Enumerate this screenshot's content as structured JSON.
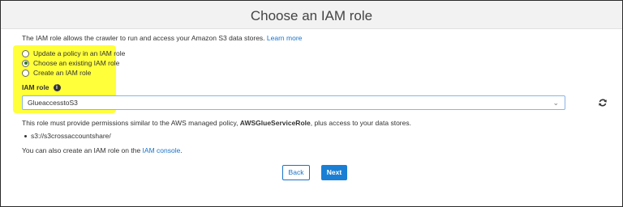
{
  "header": {
    "title": "Choose an IAM role"
  },
  "intro": {
    "text": "The IAM role allows the crawler to run and access your Amazon S3 data stores.",
    "link": "Learn more"
  },
  "role_options": [
    {
      "label": "Update a policy in an IAM role",
      "checked": false
    },
    {
      "label": "Choose an existing IAM role",
      "checked": true
    },
    {
      "label": "Create an IAM role",
      "checked": false
    }
  ],
  "iam_role": {
    "label": "IAM role",
    "info_icon": "info-icon",
    "selected": "GlueaccesstoS3",
    "refresh_icon": "refresh-icon"
  },
  "permissions": {
    "prefix": "This role must provide permissions similar to the AWS managed policy, ",
    "policy": "AWSGlueServiceRole",
    "suffix": ", plus access to your data stores."
  },
  "data_stores": [
    "s3://s3crossaccountshare/"
  ],
  "console_note": {
    "text": "You can also create an IAM role on the",
    "link": "IAM console",
    "end": "."
  },
  "buttons": {
    "back": "Back",
    "next": "Next"
  },
  "colors": {
    "accent": "#1a7fd4",
    "highlight": "#ffff3a",
    "radio_checked": "#2e7d1f"
  }
}
